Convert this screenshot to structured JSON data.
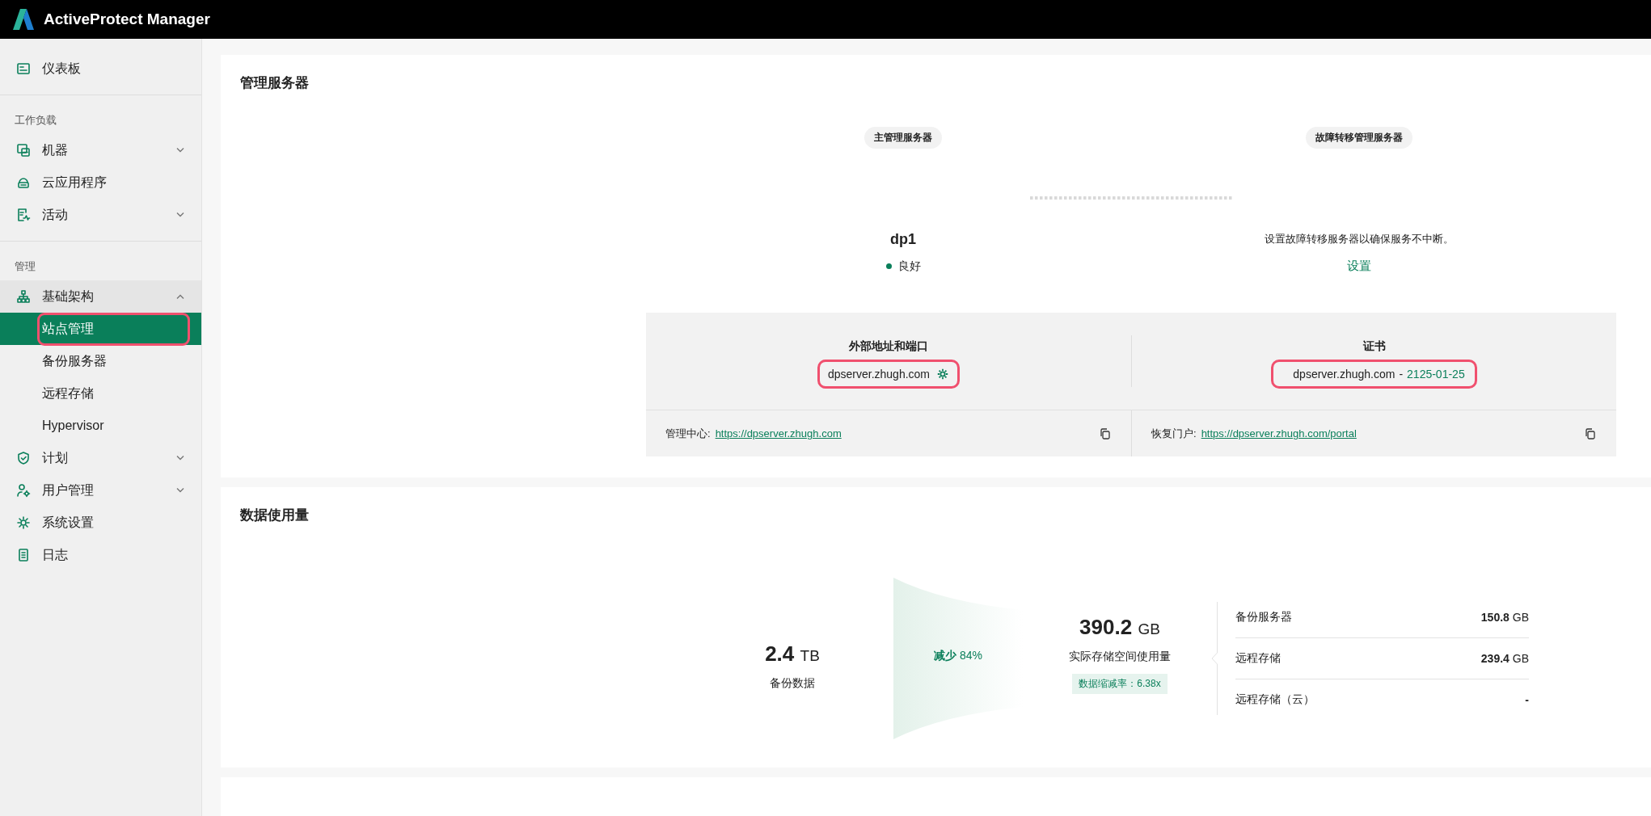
{
  "app": {
    "title": "ActiveProtect Manager"
  },
  "sidebar": {
    "top": [
      {
        "label": "仪表板",
        "selected": false
      }
    ],
    "sections": [
      {
        "title": "工作负载",
        "items": [
          {
            "label": "机器",
            "selected": false,
            "expanded": false
          },
          {
            "label": "云应用程序",
            "selected": false
          },
          {
            "label": "活动",
            "selected": false,
            "expanded": false
          }
        ]
      },
      {
        "title": "管理",
        "items": [
          {
            "label": "基础架构",
            "selected": false,
            "expanded": true,
            "children": [
              {
                "label": "站点管理",
                "selected": true,
                "highlighted": true
              },
              {
                "label": "备份服务器",
                "selected": false,
                "highlighted": false
              },
              {
                "label": "远程存储",
                "selected": false,
                "highlighted": false
              },
              {
                "label": "Hypervisor",
                "selected": false,
                "highlighted": false
              }
            ]
          },
          {
            "label": "计划",
            "selected": false,
            "expanded": false
          },
          {
            "label": "用户管理",
            "selected": false,
            "expanded": false
          },
          {
            "label": "系统设置",
            "selected": false
          },
          {
            "label": "日志",
            "selected": false
          }
        ]
      }
    ]
  },
  "server_card": {
    "title": "管理服务器",
    "primary": {
      "label": "主管理服务器",
      "name": "dp1",
      "status": "良好"
    },
    "failover": {
      "label": "故障转移管理服务器",
      "message": "设置故障转移服务器以确保服务不中断。",
      "action": "设置"
    },
    "external": {
      "title": "外部地址和端口",
      "value": "dpserver.zhugh.com",
      "highlighted": true
    },
    "certificate": {
      "title": "证书",
      "value": "dpserver.zhugh.com",
      "separator": "-",
      "expiry": "2125-01-25",
      "highlighted": true
    },
    "links": [
      {
        "label": "管理中心:",
        "url": "https://dpserver.zhugh.com"
      },
      {
        "label": "恢复门户:",
        "url": "https://dpserver.zhugh.com/portal"
      }
    ]
  },
  "data_usage": {
    "title": "数据使用量",
    "source": {
      "value": "2.4",
      "unit": "TB",
      "label": "备份数据"
    },
    "reduction": "**减少** 84%",
    "actual": {
      "value": "390.2",
      "unit": "GB",
      "label": "实际存储空间使用量",
      "ratio": "数据缩减率：6.38x"
    },
    "breakdown": [
      {
        "name": "备份服务器",
        "value": "150.8",
        "unit": "GB"
      },
      {
        "name": "远程存储",
        "value": "239.4",
        "unit": "GB"
      },
      {
        "name": "远程存储（云）",
        "value": "-"
      }
    ]
  }
}
